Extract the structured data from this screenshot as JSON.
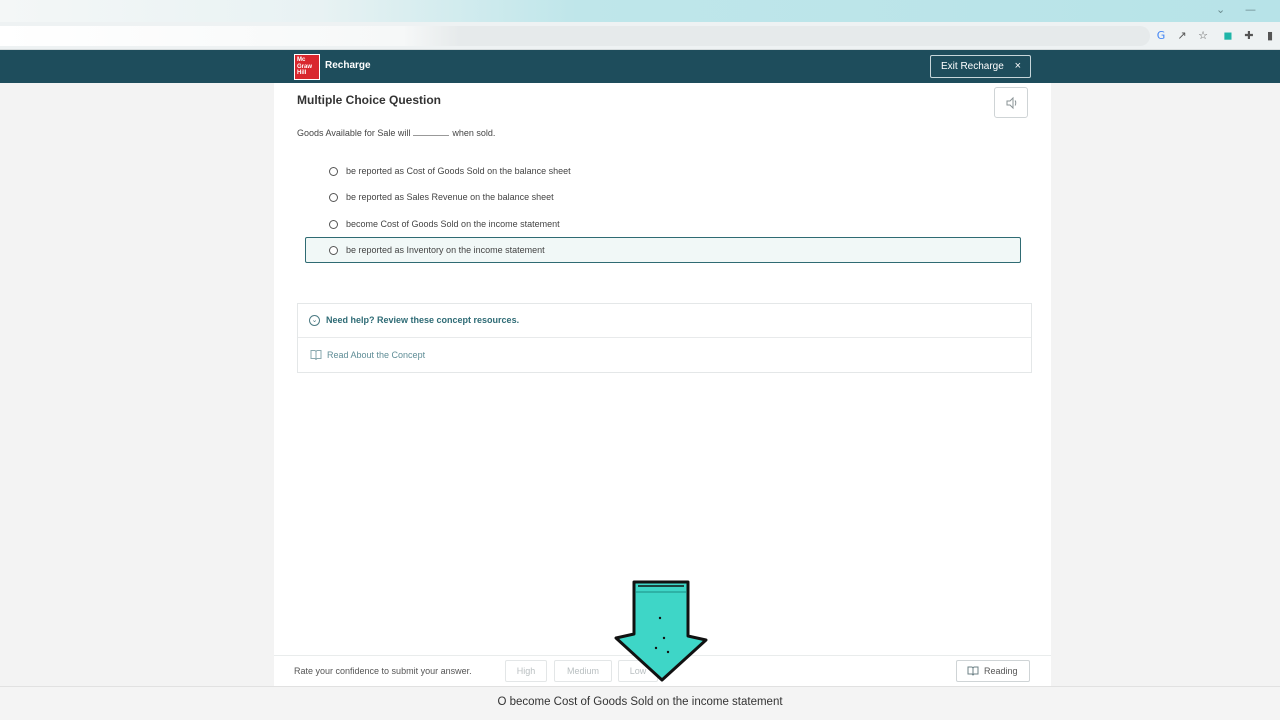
{
  "app": {
    "logo_lines": [
      "Mc",
      "Graw",
      "Hill"
    ],
    "brand": "Recharge",
    "exit_label": "Exit Recharge",
    "exit_icon": "×"
  },
  "question": {
    "heading": "Multiple Choice Question",
    "stem_before": "Goods Available for Sale will",
    "stem_after": "when sold.",
    "options": [
      "be reported as Cost of Goods Sold on the balance sheet",
      "be reported as Sales Revenue on the balance sheet",
      "become Cost of Goods Sold on the income statement",
      "be reported as Inventory on the income statement"
    ]
  },
  "help": {
    "title": "Need help? Review these concept resources.",
    "link": "Read About the Concept"
  },
  "footer": {
    "rate_label": "Rate your confidence to submit your answer.",
    "high": "High",
    "medium": "Medium",
    "low": "Low",
    "reading": "Reading"
  },
  "subtitle": "O become Cost of Goods Sold on the income statement",
  "colors": {
    "header_bg": "#1e4d5c",
    "logo_red": "#d9272e",
    "accent_teal": "#2e6b75",
    "arrow_teal": "#3ed6c7"
  }
}
